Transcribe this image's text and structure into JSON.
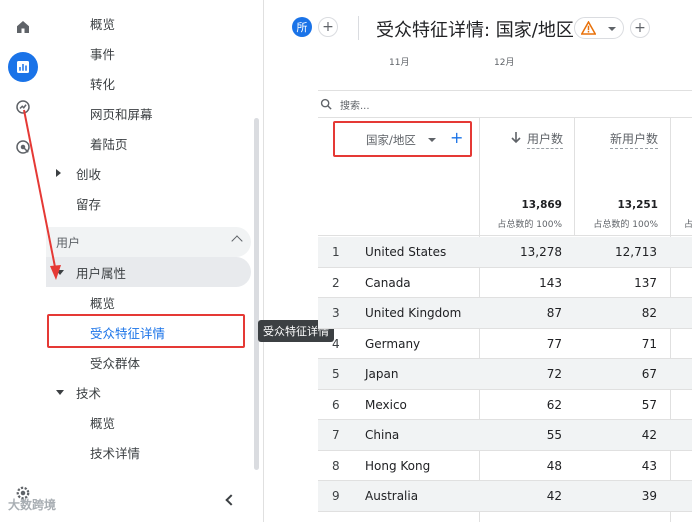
{
  "nav": {
    "items": [
      {
        "label": "概览"
      },
      {
        "label": "事件"
      },
      {
        "label": "转化"
      },
      {
        "label": "网页和屏幕"
      },
      {
        "label": "着陆页"
      },
      {
        "label": "创收"
      },
      {
        "label": "留存"
      }
    ],
    "section_user": "用户",
    "user_attr": "用户属性",
    "user_attr_children": [
      {
        "label": "概览"
      },
      {
        "label": "受众特征详情"
      },
      {
        "label": "受众群体"
      }
    ],
    "tech": "技术",
    "tech_children": [
      {
        "label": "概览"
      },
      {
        "label": "技术详情"
      }
    ]
  },
  "tooltip": "受众特征详情",
  "header": {
    "badge": "所",
    "title": "受众特征详情: 国家/地区"
  },
  "months": [
    "11月",
    "12月"
  ],
  "search": {
    "placeholder": "搜索..."
  },
  "table": {
    "dimension": "国家/地区",
    "metric_users": "用户数",
    "metric_new_users": "新用户数",
    "total_users": "13,869",
    "total_new_users": "13,251",
    "total_users_pct": "占总数的 100%",
    "total_new_pct": "占总数的 100%",
    "rows": [
      {
        "idx": "1",
        "country": "United States",
        "users": "13,278",
        "new_users": "12,713"
      },
      {
        "idx": "2",
        "country": "Canada",
        "users": "143",
        "new_users": "137"
      },
      {
        "idx": "3",
        "country": "United Kingdom",
        "users": "87",
        "new_users": "82"
      },
      {
        "idx": "4",
        "country": "Germany",
        "users": "77",
        "new_users": "71"
      },
      {
        "idx": "5",
        "country": "Japan",
        "users": "72",
        "new_users": "67"
      },
      {
        "idx": "6",
        "country": "Mexico",
        "users": "62",
        "new_users": "57"
      },
      {
        "idx": "7",
        "country": "China",
        "users": "55",
        "new_users": "42"
      },
      {
        "idx": "8",
        "country": "Hong Kong",
        "users": "48",
        "new_users": "43"
      },
      {
        "idx": "9",
        "country": "Australia",
        "users": "42",
        "new_users": "39"
      }
    ]
  },
  "watermark": "大数跨境",
  "colors": {
    "accent": "#1a73e8",
    "highlight_red": "#e53935"
  }
}
